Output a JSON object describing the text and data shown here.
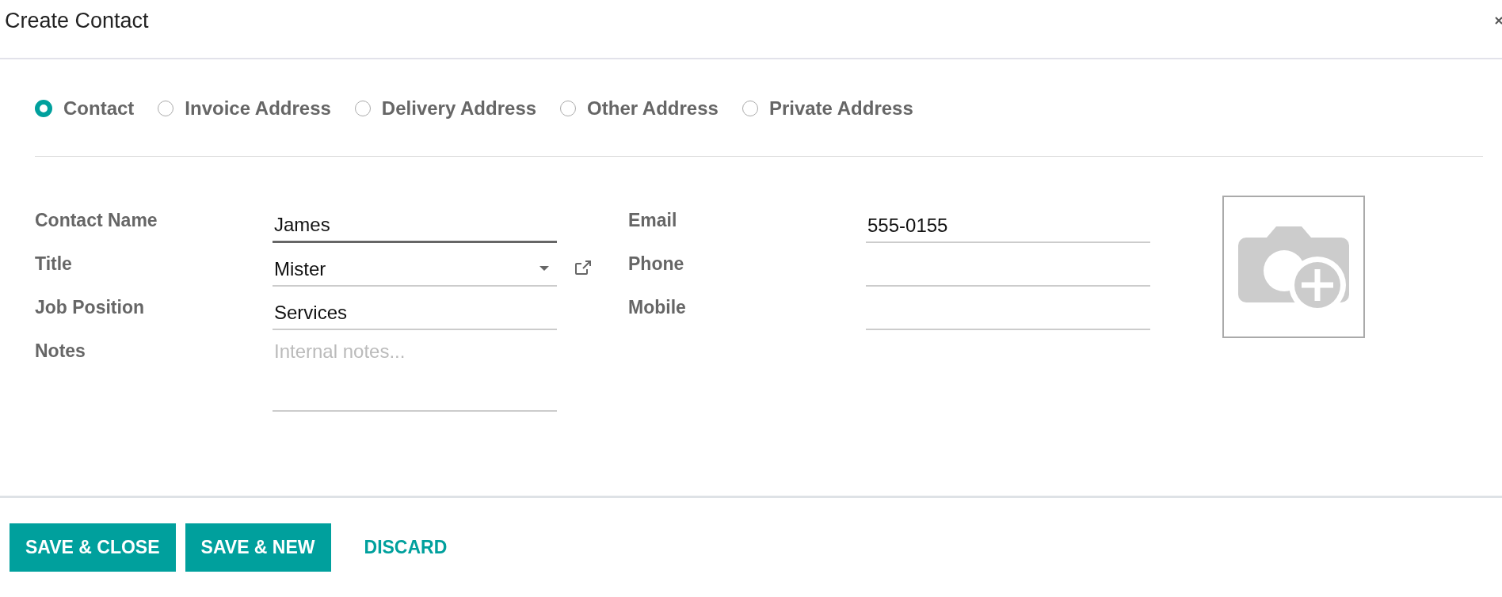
{
  "dialog": {
    "title": "Create Contact"
  },
  "address_types": [
    {
      "label": "Contact",
      "selected": true
    },
    {
      "label": "Invoice Address",
      "selected": false
    },
    {
      "label": "Delivery Address",
      "selected": false
    },
    {
      "label": "Other Address",
      "selected": false
    },
    {
      "label": "Private Address",
      "selected": false
    }
  ],
  "left_fields": [
    {
      "label": "Contact Name",
      "value": "James",
      "kind": "text",
      "focused": true
    },
    {
      "label": "Title",
      "value": "Mister",
      "kind": "select",
      "focused": false
    },
    {
      "label": "Job Position",
      "value": "Services",
      "kind": "text",
      "focused": false
    },
    {
      "label": "Notes",
      "placeholder": "Internal notes...",
      "kind": "textarea",
      "focused": false
    }
  ],
  "right_fields": [
    {
      "label": "Email",
      "value": "555-0155"
    },
    {
      "label": "Phone"
    },
    {
      "label": "Mobile"
    }
  ],
  "buttons": [
    {
      "label": "SAVE & CLOSE",
      "kind": "primary"
    },
    {
      "label": "SAVE & NEW",
      "kind": "primary"
    },
    {
      "label": "DISCARD",
      "kind": "link"
    }
  ]
}
